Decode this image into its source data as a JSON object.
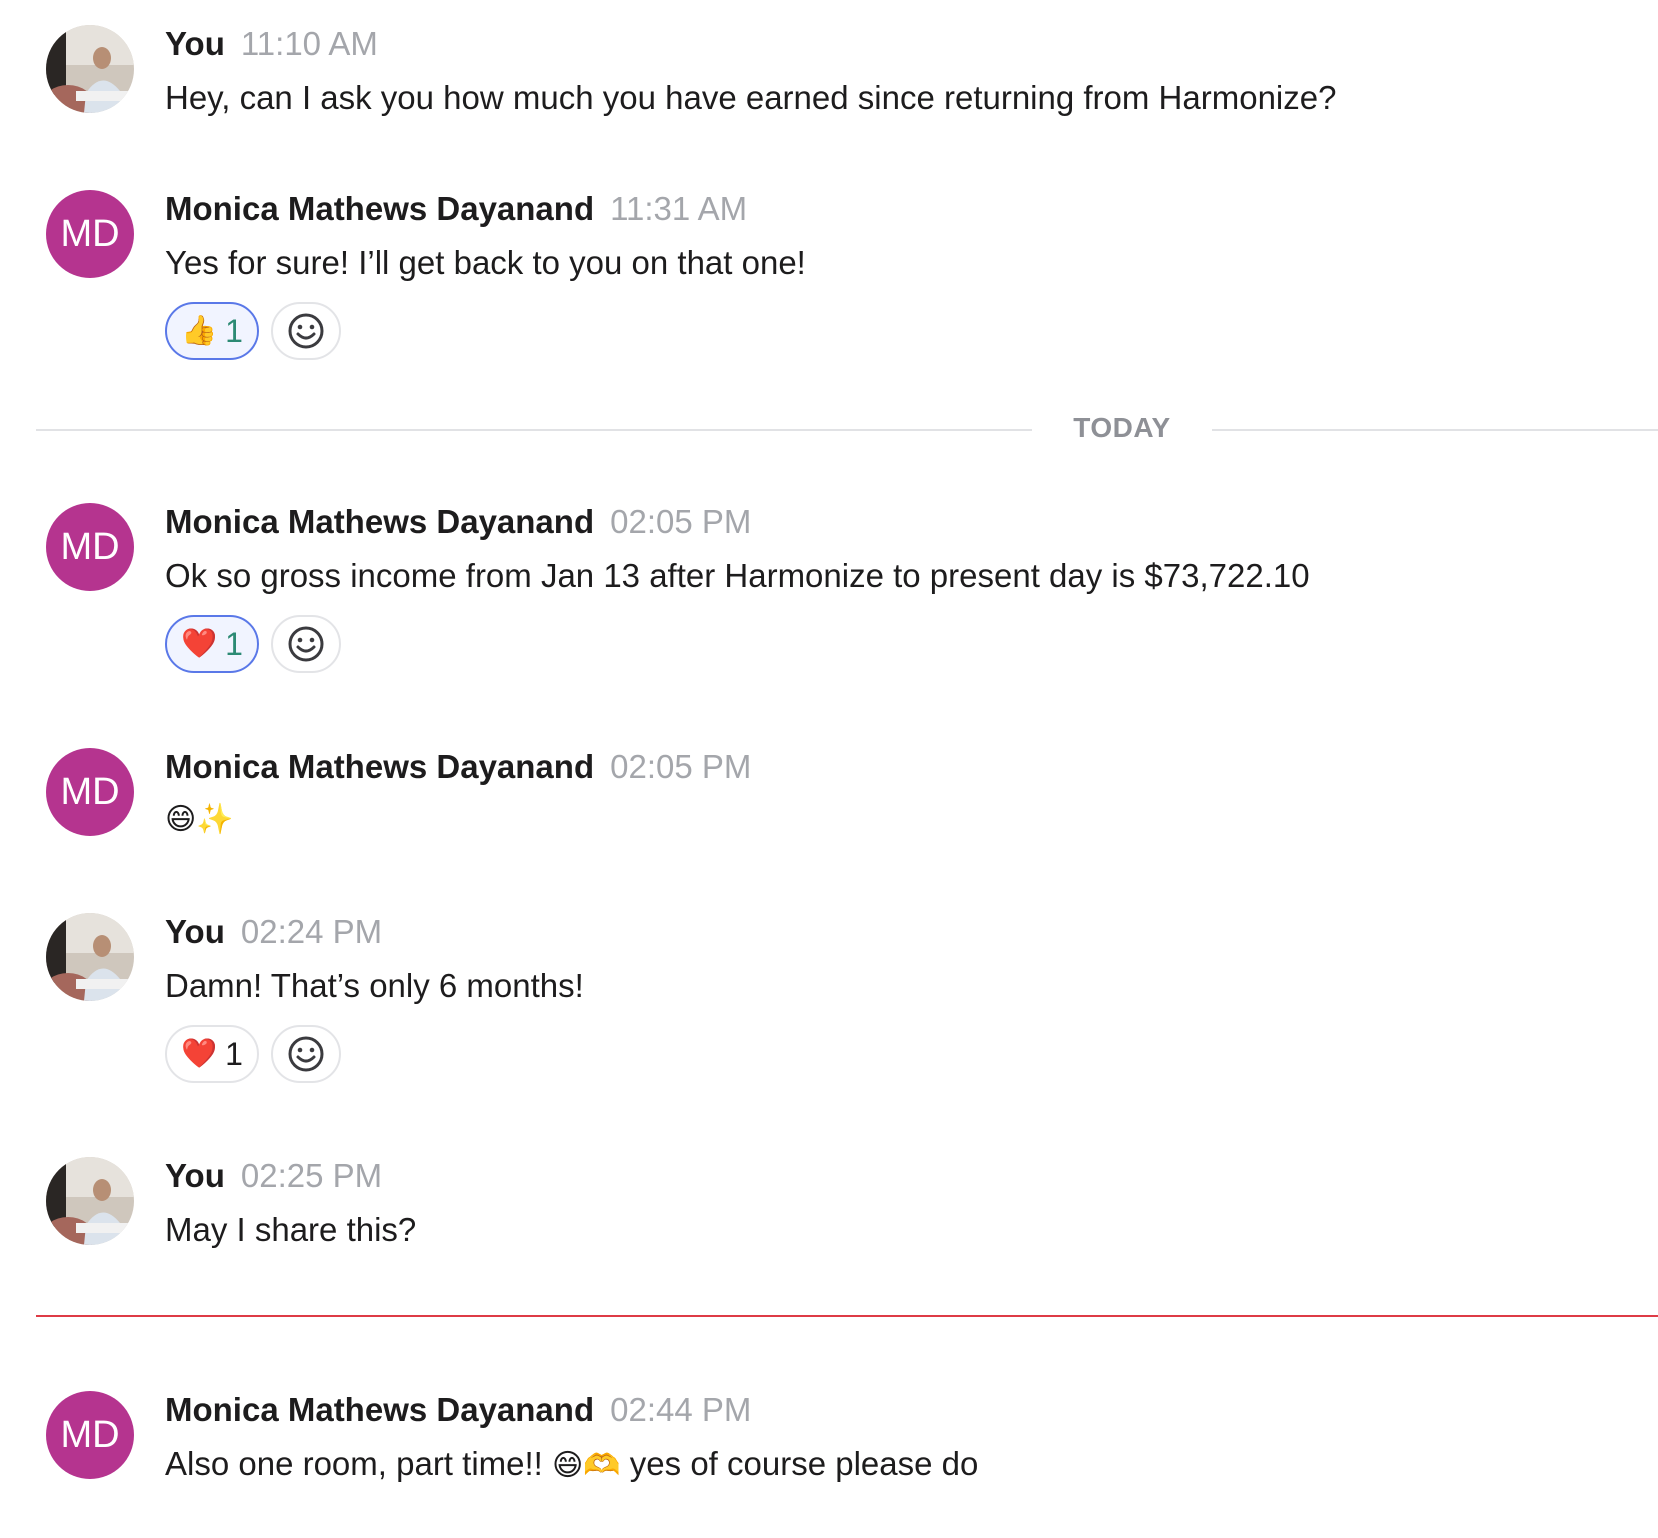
{
  "messages": [
    {
      "sender": "You",
      "time": "11:10 AM",
      "text": "Hey, can I ask you how much you have earned since returning from Harmonize?",
      "avatar": {
        "type": "photo"
      }
    },
    {
      "sender": "Monica Mathews Dayanand",
      "time": "11:31 AM",
      "text": "Yes for sure! I’ll get back to you on that one!",
      "avatar": {
        "type": "initials",
        "initials": "MD",
        "color": "#b5348f"
      },
      "reactions": [
        {
          "emoji": "👍",
          "count": "1",
          "reacted_by_you": true
        }
      ]
    },
    {
      "sender": "Monica Mathews Dayanand",
      "time": "02:05 PM",
      "text": "Ok so gross income from Jan 13 after Harmonize to present day is $73,722.10",
      "avatar": {
        "type": "initials",
        "initials": "MD",
        "color": "#b5348f"
      },
      "reactions": [
        {
          "emoji": "❤️",
          "count": "1",
          "reacted_by_you": true
        }
      ]
    },
    {
      "sender": "Monica Mathews Dayanand",
      "time": "02:05 PM",
      "text": "😄✨",
      "avatar": {
        "type": "initials",
        "initials": "MD",
        "color": "#b5348f"
      }
    },
    {
      "sender": "You",
      "time": "02:24 PM",
      "text": "Damn! That’s only 6 months!",
      "avatar": {
        "type": "photo"
      },
      "reactions": [
        {
          "emoji": "❤️",
          "count": "1",
          "reacted_by_you": false
        }
      ]
    },
    {
      "sender": "You",
      "time": "02:25 PM",
      "text": "May I share this?",
      "avatar": {
        "type": "photo"
      }
    },
    {
      "sender": "Monica Mathews Dayanand",
      "time": "02:44 PM",
      "text_before_emoji": "Also one room, part time!! ",
      "emoji": "😄🫶",
      "text_after_emoji": " yes of course please do",
      "avatar": {
        "type": "initials",
        "initials": "MD",
        "color": "#b5348f"
      }
    }
  ],
  "day_divider": {
    "label": "TODAY"
  },
  "colors": {
    "avatar_bg": "#b5348f",
    "reaction_active_border": "#5a78e8",
    "reaction_count_active": "#2c8a74",
    "new_messages_line": "#de3b46",
    "timestamp": "#a4a6ab"
  },
  "icons": {
    "add_reaction": "smiley-face-icon"
  }
}
